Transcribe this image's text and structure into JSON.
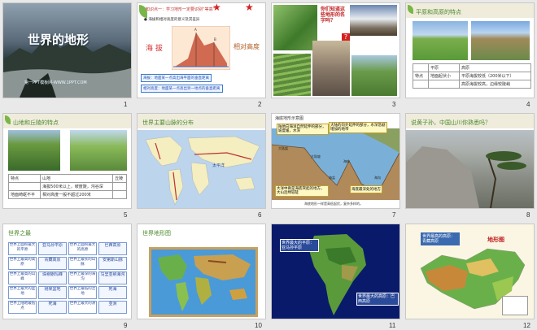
{
  "slides": [
    {
      "number": "1",
      "title": "世界的地形",
      "subtitle": "第一PPT模板网-WWW.1PPT.COM"
    },
    {
      "number": "2",
      "heading": "知识点一：学习地形一定要识别“等高”",
      "bullet": "● 海拔和相对高度的意义及其差异",
      "label_left": "海 拔",
      "label_right": "相对高度",
      "label_a": "A",
      "label_b": "B",
      "def_altitude": "海拔：地面某一点高出海平面的垂直距离",
      "def_relative": "相对高度：地面某一点高出另一地点的垂直距离"
    },
    {
      "number": "3",
      "question": "你们知道这些地形的名字吗？",
      "qmark": "?"
    },
    {
      "number": "4",
      "heading": "平原和高原的特点",
      "rows": [
        [
          "",
          "平原",
          "高原"
        ],
        [
          "特点",
          "地面起伏小",
          "平原海拔较低（200米以下）"
        ],
        [
          "",
          "",
          "高原海拔较高，边缘较陡峭"
        ]
      ]
    },
    {
      "number": "5",
      "heading": "山地和丘陵的特点",
      "rows": [
        [
          "特点",
          "山地",
          "丘陵"
        ],
        [
          "",
          "海拔500米以上，坡度陡，沟谷深",
          ""
        ],
        [
          "地面崎岖不平",
          "相对高度一般不超过200米",
          ""
        ]
      ]
    },
    {
      "number": "6",
      "heading": "世界主要山脉的分布",
      "ocean": "太平洋"
    },
    {
      "number": "7",
      "heading": "海底地形示意图",
      "callout_1": "陆地向海洋自然延伸的部分，坡度缓，水深",
      "callout_2": "大陆的向外延伸的部分，水深急剧增加的地带",
      "callout_3": "大洋中脊是海底突起的地方，大山连绵较陡",
      "callout_4": "海底最深处的地方",
      "label_mainland": "大陆架",
      "label_slope": "大陆坡",
      "label_ridge": "海岭",
      "label_basin": "海盆",
      "label_trench": "海沟",
      "caption": "海底地形一样是高低起伏，复杂多样的。"
    },
    {
      "number": "8",
      "heading": "说黄子孙，中国山川你熟悉吗？"
    },
    {
      "number": "9",
      "heading": "世界之最",
      "cells": [
        "世界上面积最大的平原",
        "亚马孙平原",
        "世界上面积最大的高原",
        "巴西高原",
        "世界上最高的高原",
        "青藏高原",
        "世界上最长的山脉",
        "安第斯山脉",
        "世界上最高的山峰",
        "珠穆朗玛峰",
        "世界上最深的海沟",
        "马里亚纳海沟",
        "世界上最大的盆地",
        "刚果盆地",
        "世界上最低的洼地",
        "死海",
        "世界上陆地最低点",
        "死海",
        "世界上最大的洲",
        "亚洲"
      ]
    },
    {
      "number": "10",
      "heading": "世界地形图"
    },
    {
      "number": "11",
      "label_1": "世界最大的平原：亚马孙平原",
      "label_2": "世界最大的高原：巴西高原"
    },
    {
      "number": "12",
      "plateau": "青藏高原",
      "map_title": "地形图",
      "label": "世界最高的高原：青藏高原"
    }
  ],
  "colors": {
    "title_white": "#ffffff",
    "accent_green": "#4a8a2a",
    "accent_red": "#d42020"
  }
}
